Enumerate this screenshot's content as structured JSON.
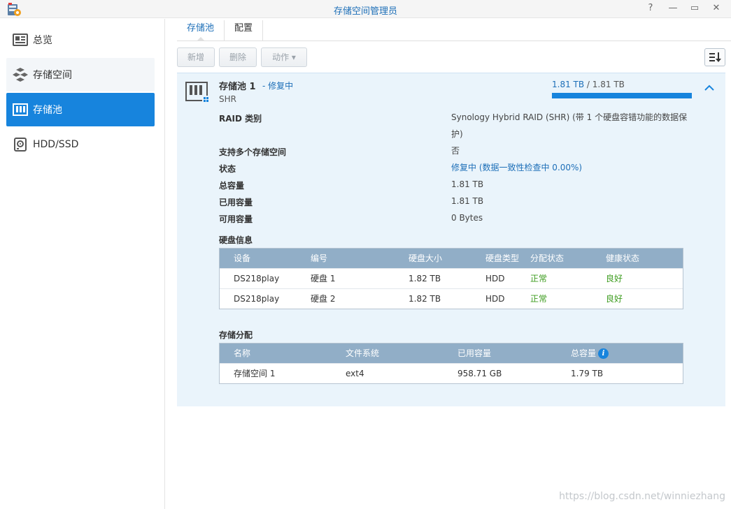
{
  "window": {
    "title": "存储空间管理员",
    "help": "?",
    "minimize": "—",
    "maximize": "▭",
    "close": "✕"
  },
  "sidebar": {
    "items": [
      {
        "label": "总览",
        "icon": "overview-icon",
        "state": "normal"
      },
      {
        "label": "存储空间",
        "icon": "volume-icon",
        "state": "hover"
      },
      {
        "label": "存储池",
        "icon": "storage-pool-icon",
        "state": "active"
      },
      {
        "label": "HDD/SSD",
        "icon": "hdd-icon",
        "state": "normal"
      }
    ]
  },
  "tabs": [
    {
      "label": "存储池",
      "active": true
    },
    {
      "label": "配置",
      "active": false
    }
  ],
  "toolbar": {
    "create_label": "新增",
    "delete_label": "删除",
    "action_label": "动作 ▾"
  },
  "pool": {
    "name": "存储池 1",
    "status": "- 修复中",
    "type": "SHR",
    "capacity_used": "1.81 TB",
    "capacity_sep": " / ",
    "capacity_total": "1.81 TB",
    "usage_fraction": 1.0,
    "properties": [
      {
        "label": "RAID 类别",
        "value": "Synology Hybrid RAID (SHR) (带 1 个硬盘容错功能的数据保护)",
        "blue": false
      },
      {
        "label": "支持多个存储空间",
        "value": "否",
        "blue": false
      },
      {
        "label": "状态",
        "value": "修复中 (数据一致性检查中 0.00%)",
        "blue": true
      },
      {
        "label": "总容量",
        "value": "1.81 TB",
        "blue": false
      },
      {
        "label": "已用容量",
        "value": "1.81 TB",
        "blue": false
      },
      {
        "label": "可用容量",
        "value": "0 Bytes",
        "blue": false
      }
    ],
    "disk_section_title": "硬盘信息",
    "disk_columns": [
      "设备",
      "编号",
      "硬盘大小",
      "硬盘类型",
      "分配状态",
      "健康状态"
    ],
    "disks": [
      [
        "DS218play",
        "硬盘 1",
        "1.82 TB",
        "HDD",
        "正常",
        "良好"
      ],
      [
        "DS218play",
        "硬盘 2",
        "1.82 TB",
        "HDD",
        "正常",
        "良好"
      ]
    ],
    "alloc_section_title": "存储分配",
    "alloc_columns": [
      "名称",
      "文件系统",
      "已用容量",
      "总容量"
    ],
    "allocations": [
      [
        "存储空间 1",
        "ext4",
        "958.71 GB",
        "1.79 TB"
      ]
    ],
    "info_glyph": "i"
  },
  "colors": {
    "accent": "#1784dd",
    "link": "#1d6fb8",
    "healthy": "#3d9c1f",
    "grid_header": "#91aec7",
    "panel_bg": "#eaf4fb"
  },
  "watermark": "https://blog.csdn.net/winniezhang"
}
